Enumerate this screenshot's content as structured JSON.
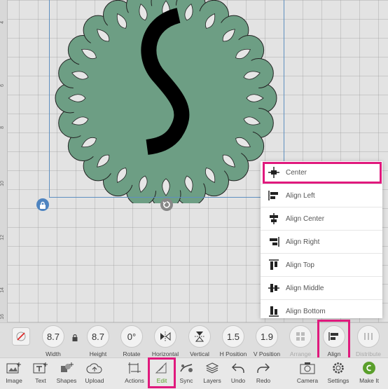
{
  "ruler": {
    "ticks": [
      "4",
      "6",
      "8",
      "10",
      "12",
      "14",
      "16"
    ]
  },
  "align_menu": {
    "items": [
      {
        "label": "Center",
        "icon": "align-center-icon"
      },
      {
        "label": "Align Left",
        "icon": "align-left-icon"
      },
      {
        "label": "Align Center",
        "icon": "align-center-horizontal-icon"
      },
      {
        "label": "Align Right",
        "icon": "align-right-icon"
      },
      {
        "label": "Align Top",
        "icon": "align-top-icon"
      },
      {
        "label": "Align Middle",
        "icon": "align-middle-icon"
      },
      {
        "label": "Align Bottom",
        "icon": "align-bottom-icon"
      }
    ]
  },
  "toolbar": {
    "width_value": "8.7",
    "width_label": "Width",
    "height_value": "8.7",
    "height_label": "Height",
    "rotate_value": "0°",
    "rotate_label": "Rotate",
    "horizontal_label": "Horizontal",
    "vertical_label": "Vertical",
    "hpos_value": "1.5",
    "hpos_label": "H Position",
    "vpos_value": "1.9",
    "vpos_label": "V Position",
    "arrange_label": "Arrange",
    "align_label": "Align",
    "distribute_label": "Distribute"
  },
  "bottom_bar": {
    "image": "Image",
    "text": "Text",
    "shapes": "Shapes",
    "upload": "Upload",
    "actions": "Actions",
    "edit": "Edit",
    "sync": "Sync",
    "layers": "Layers",
    "undo": "Undo",
    "redo": "Redo",
    "camera": "Camera",
    "settings": "Settings",
    "make_it": "Make It"
  },
  "colors": {
    "design_fill": "#6d9e84",
    "highlight": "#e0197d",
    "active": "#5a9f2b"
  }
}
